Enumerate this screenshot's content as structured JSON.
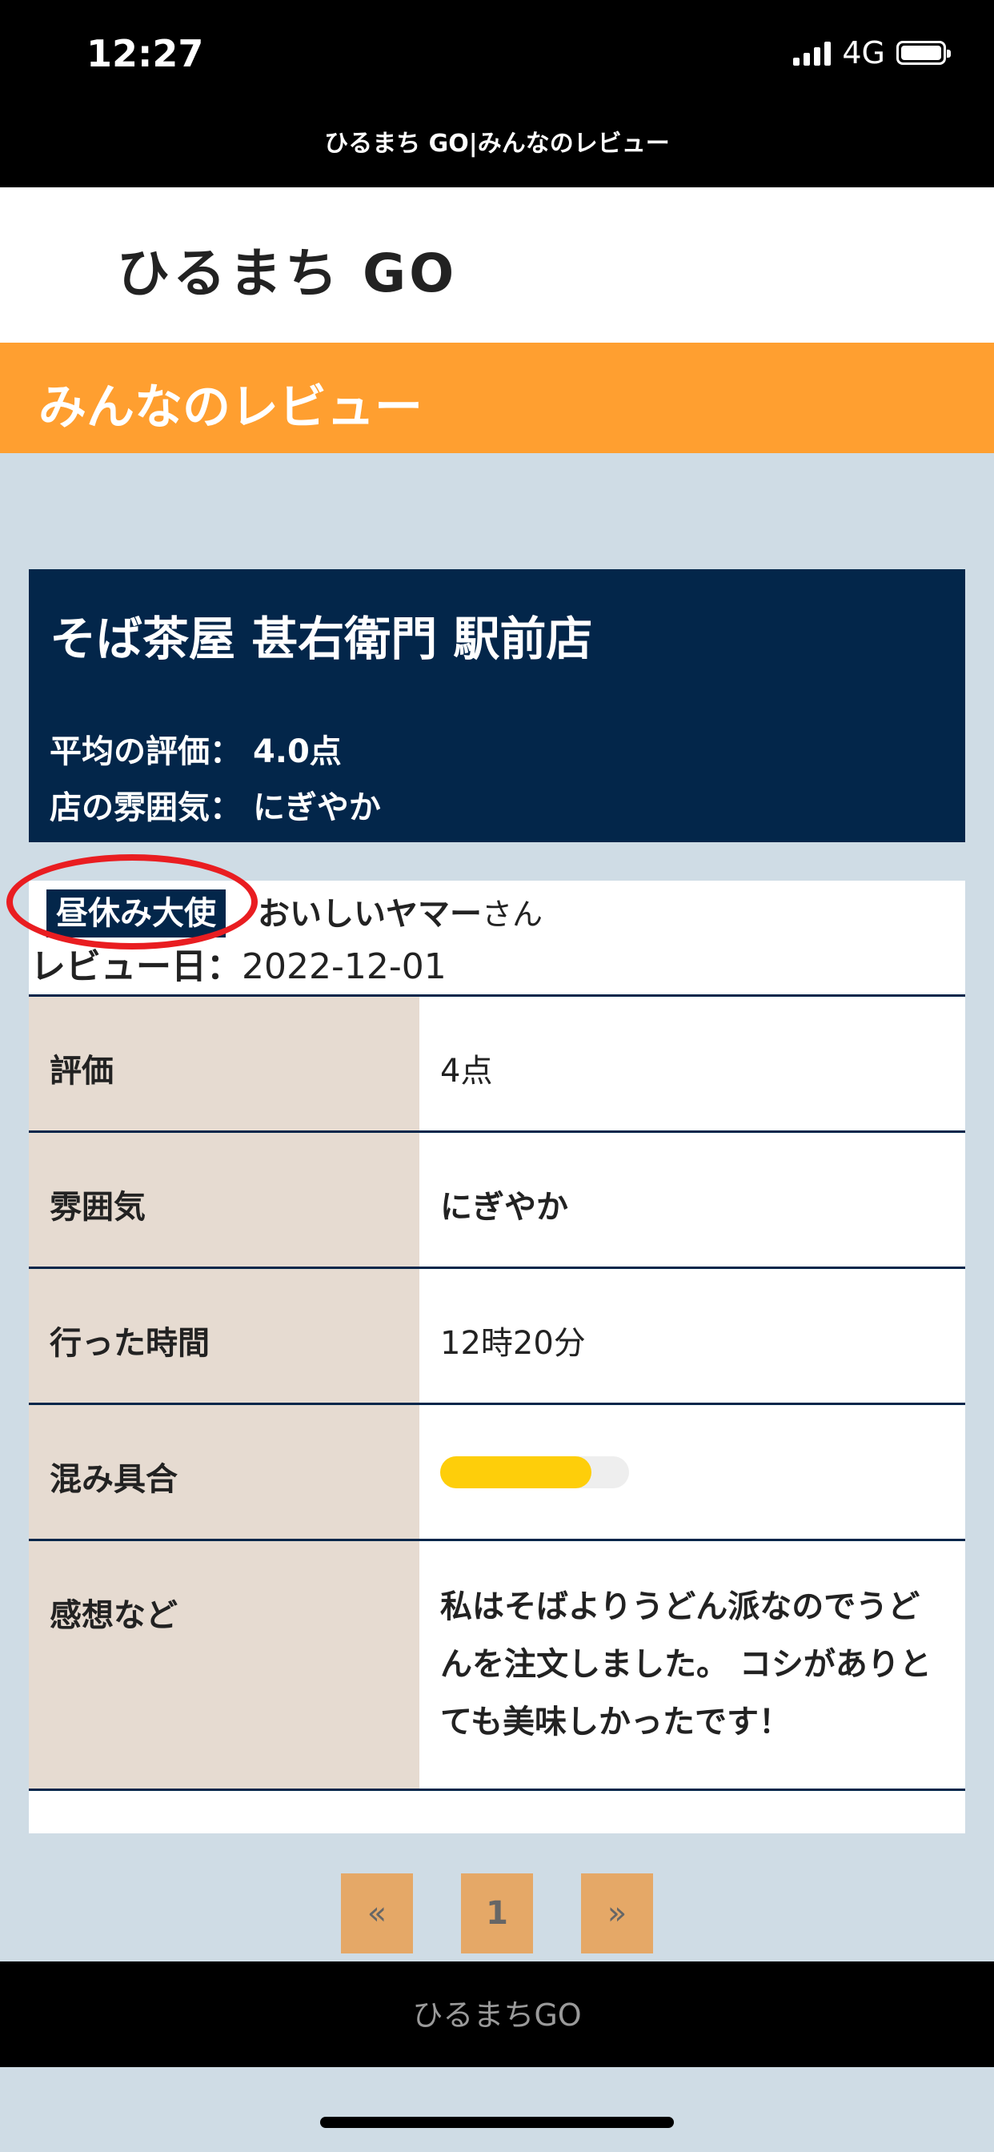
{
  "status_bar": {
    "time": "12:27",
    "network": "4G"
  },
  "browser": {
    "page_title": "ひるまち GO|みんなのレビュー"
  },
  "site": {
    "logo": "ひるまち GO"
  },
  "banner": {
    "title": "みんなのレビュー"
  },
  "shop": {
    "name": "そば茶屋 甚右衛門 駅前店",
    "avg_label": "平均の評価：",
    "avg_value": "4.0点",
    "atmosphere_label": "店の雰囲気：",
    "atmosphere_value": "にぎやか"
  },
  "review": {
    "badge": "昼休み大使",
    "reviewer_name": "おいしいヤマー",
    "reviewer_suffix": "さん",
    "date_label": "レビュー日：",
    "date": "2022-12-01",
    "rows": [
      {
        "label": "評価",
        "value": "4点"
      },
      {
        "label": "雰囲気",
        "value": "にぎやか"
      },
      {
        "label": "行った時間",
        "value": "12時20分"
      },
      {
        "label": "混み具合",
        "level": 0.8
      },
      {
        "label": "感想など",
        "value": "私はそばよりうどん派なのでうどんを注文しました。 コシがありとても美味しかったです！"
      }
    ],
    "colors": {
      "crowd_fill": "#fece0a",
      "crowd_track": "#eeeeee"
    }
  },
  "pagination": {
    "prev": "«",
    "current": "1",
    "next": "»"
  },
  "footer": {
    "text": "ひるまちGO"
  },
  "colors": {
    "banner": "#ff9f30",
    "navy": "#03264a",
    "highlight_ring": "#e91d21",
    "background": "#cfdce5"
  }
}
